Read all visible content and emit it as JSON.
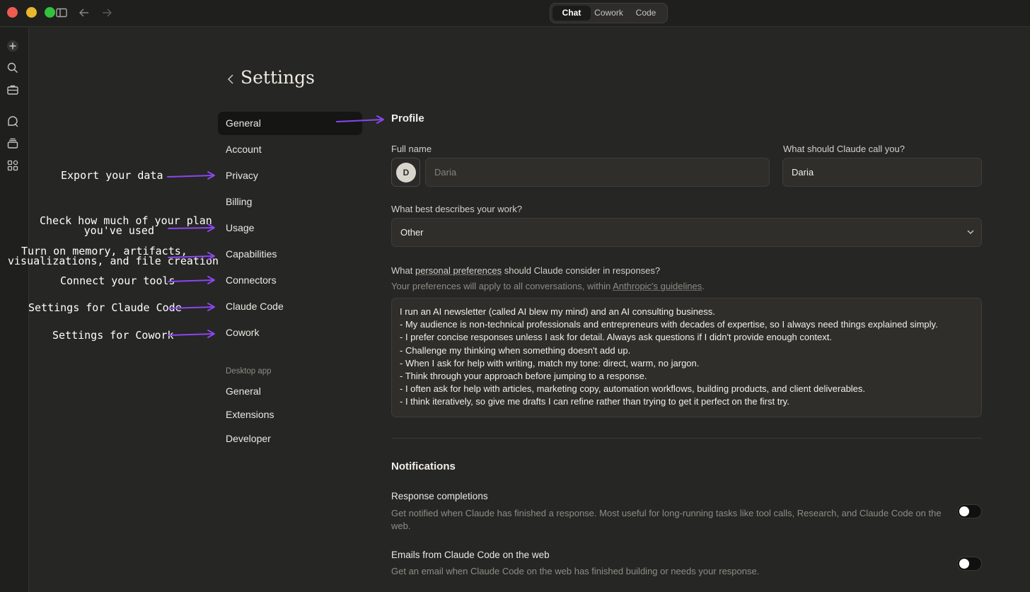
{
  "titlebar": {
    "modes": [
      "Chat",
      "Cowork",
      "Code"
    ],
    "active_mode": "Chat"
  },
  "settings": {
    "title": "Settings",
    "nav": [
      "General",
      "Account",
      "Privacy",
      "Billing",
      "Usage",
      "Capabilities",
      "Connectors",
      "Claude Code",
      "Cowork"
    ],
    "active_nav": "General",
    "desktop_section_label": "Desktop app",
    "desktop_nav": [
      "General",
      "Extensions",
      "Developer"
    ]
  },
  "annotations": {
    "privacy": "Export your data",
    "usage_line1": "Check how much of your plan",
    "usage_line2": "you've used",
    "capabilities_line1": "Turn on memory, artifacts,",
    "capabilities_line2": "visualizations, and file creation",
    "connectors": "Connect your tools",
    "claude_code": "Settings for Claude Code",
    "cowork": "Settings for Cowork"
  },
  "profile": {
    "heading": "Profile",
    "full_name_label": "Full name",
    "avatar_initial": "D",
    "full_name_placeholder": "Daria",
    "call_you_label": "What should Claude call you?",
    "call_you_value": "Daria",
    "work_label": "What best describes your work?",
    "work_value": "Other",
    "prefs_label_pre": "What ",
    "prefs_label_link": "personal preferences",
    "prefs_label_post": " should Claude consider in responses?",
    "prefs_sub_pre": "Your preferences will apply to all conversations, within ",
    "prefs_sub_link": "Anthropic's guidelines",
    "prefs_sub_post": ".",
    "preferences": [
      "I run an AI newsletter (called AI blew my mind) and an AI consulting business.",
      "- My audience is non-technical professionals and entrepreneurs with decades of expertise, so I always need things explained simply.",
      "- I prefer concise responses unless I ask for detail. Always ask questions if I didn't provide enough context.",
      "- Challenge my thinking when something doesn't add up.",
      "- When I ask for help with writing, match my tone: direct, warm, no jargon.",
      "- Think through your approach before jumping to a response.",
      "- I often ask for help with articles, marketing copy, automation workflows, building products, and client deliverables.",
      "- I think iteratively, so give me drafts I can refine rather than trying to get it perfect on the first try."
    ]
  },
  "notifications": {
    "heading": "Notifications",
    "items": [
      {
        "title": "Response completions",
        "desc": "Get notified when Claude has finished a response. Most useful for long-running tasks like tool calls, Research, and Claude Code on the web.",
        "enabled": false
      },
      {
        "title": "Emails from Claude Code on the web",
        "desc": "Get an email when Claude Code on the web has finished building or needs your response.",
        "enabled": false
      }
    ]
  },
  "colors": {
    "background": "#262624",
    "arrow": "#8b46f0",
    "active_nav": "#151514"
  },
  "icons": [
    "sidebar-toggle-icon",
    "arrow-left-icon",
    "arrow-right-icon",
    "plus-icon",
    "search-icon",
    "briefcase-icon",
    "chat-search-icon",
    "stack-icon",
    "apps-icon",
    "chevron-left-icon",
    "chevron-down-icon"
  ]
}
